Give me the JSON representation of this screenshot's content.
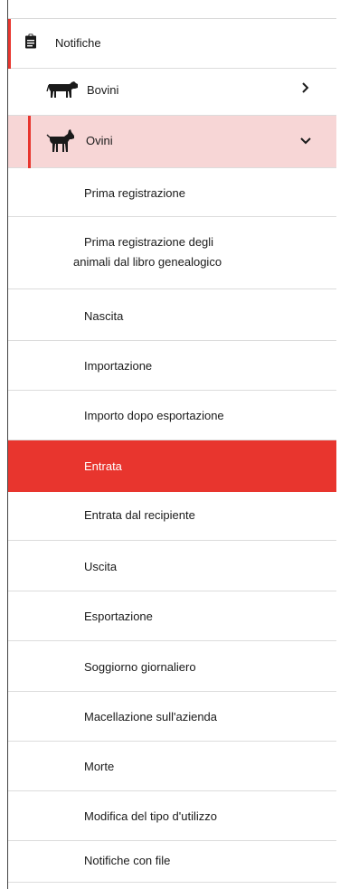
{
  "nav": {
    "notifiche": {
      "label": "Notifiche",
      "icon": "clipboard-icon"
    },
    "bovini": {
      "label": "Bovini",
      "icon": "cow-icon",
      "chevron": "chevron-right-icon"
    },
    "ovini": {
      "label": "Ovini",
      "icon": "goat-icon",
      "chevron": "chevron-down-icon"
    },
    "ovini_items": [
      {
        "label": "Prima registrazione"
      },
      {
        "label_line1": "Prima registrazione degli",
        "label_line2": "animali dal libro genealogico"
      },
      {
        "label": "Nascita"
      },
      {
        "label": "Importazione"
      },
      {
        "label": "Importo dopo esportazione"
      },
      {
        "label": "Entrata",
        "active": true
      },
      {
        "label": "Entrata dal recipiente"
      },
      {
        "label": "Uscita"
      },
      {
        "label": "Esportazione"
      },
      {
        "label": "Soggiorno giornaliero"
      },
      {
        "label": "Macellazione sull'azienda"
      },
      {
        "label": "Morte"
      },
      {
        "label": "Modifica del tipo d'utilizzo"
      },
      {
        "label": "Notifiche con file"
      }
    ]
  },
  "colors": {
    "accent": "#e8352e",
    "expanded_bg": "#f7d6d6",
    "divider": "#dcdcdc"
  }
}
